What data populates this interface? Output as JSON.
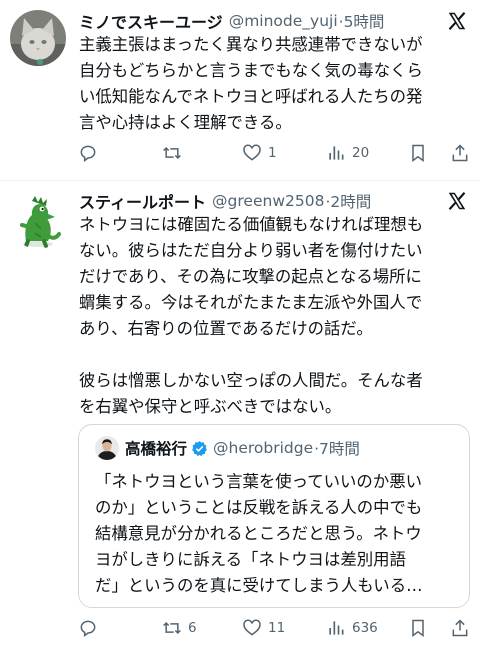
{
  "posts": [
    {
      "name": "ミノでスキーユージ",
      "handle": "@minode_yuji",
      "time": "·5時間",
      "text": "主義主張はまったく異なり共感連帯できないが\n自分もどちらかと言うまでもなく気の毒なくら\nい低知能なんでネトウヨと呼ばれる人たちの発\n言や心持はよく理解できる。",
      "actions": {
        "reply": "",
        "repost": "",
        "like": "1",
        "views": "20"
      }
    },
    {
      "name": "スティールポート",
      "handle": "@greenw2508",
      "time": "·2時間",
      "text": "ネトウヨには確固たる価値観もなければ理想も\nない。彼らはただ自分より弱い者を傷付けたい\nだけであり、その為に攻撃の起点となる場所に\n蝟集する。今はそれがたまたま左派や外国人で\nあり、右寄りの位置であるだけの話だ。\n\n彼らは憎悪しかない空っぽの人間だ。そんな者\nを右翼や保守と呼ぶべきではない。",
      "quote": {
        "name": "高橋裕行",
        "handle": "@herobridge",
        "time": "·7時間",
        "text": "「ネトウヨという言葉を使っていいのか悪い\nのか」ということは反戦を訴える人の中でも\n結構意見が分かれるところだと思う。ネトウ\nヨがしきりに訴える「ネトウヨは差別用語\nだ」というのを真に受けてしまう人もいる…"
      },
      "actions": {
        "reply": "",
        "repost": "6",
        "like": "11",
        "views": "636"
      }
    }
  ],
  "colors": {
    "text": "#0f1419",
    "secondary": "#536471",
    "border": "#cfd9de",
    "verified": "#1d9bf0"
  },
  "icons": [
    "x-logo-icon",
    "reply-icon",
    "repost-icon",
    "like-icon",
    "views-icon",
    "bookmark-icon",
    "share-icon",
    "verified-badge-icon"
  ]
}
